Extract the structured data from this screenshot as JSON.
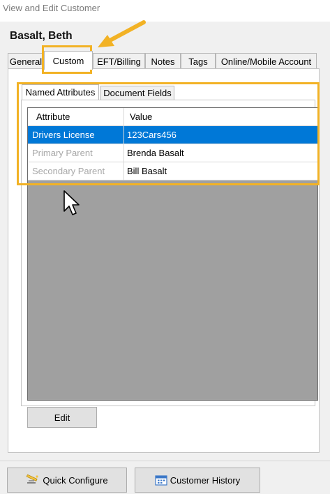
{
  "window": {
    "title": "View and Edit Customer"
  },
  "customer": {
    "name": "Basalt, Beth"
  },
  "outer_tabs": [
    {
      "label": "General"
    },
    {
      "label": "Custom"
    },
    {
      "label": "EFT/Billing"
    },
    {
      "label": "Notes"
    },
    {
      "label": "Tags"
    },
    {
      "label": "Online/Mobile Account"
    }
  ],
  "inner_tabs": [
    {
      "label": "Named Attributes"
    },
    {
      "label": "Document Fields"
    }
  ],
  "grid": {
    "columns": [
      "Attribute",
      "Value"
    ],
    "rows": [
      {
        "attribute": "Drivers License",
        "value": "123Cars456"
      },
      {
        "attribute": "Primary Parent",
        "value": "Brenda Basalt"
      },
      {
        "attribute": "Secondary Parent",
        "value": "Bill Basalt"
      }
    ]
  },
  "buttons": {
    "edit": "Edit",
    "quick_configure": "Quick Configure",
    "customer_history": "Customer History"
  },
  "colors": {
    "selection": "#0078d7",
    "annotation": "#f2b225"
  },
  "icons": {
    "quick_configure": "wand-icon",
    "customer_history": "calendar-icon",
    "annotation_arrow": "arrow-icon",
    "cursor": "mouse-pointer-icon"
  }
}
